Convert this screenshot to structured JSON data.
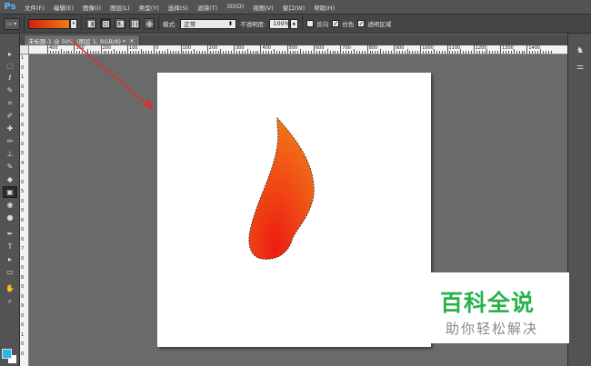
{
  "app": {
    "logo": "Ps",
    "menu": [
      "文件(F)",
      "编辑(E)",
      "图像(I)",
      "图层(L)",
      "类型(Y)",
      "选择(S)",
      "滤镜(T)",
      "3D(D)",
      "视图(V)",
      "窗口(W)",
      "帮助(H)"
    ]
  },
  "options_bar": {
    "mode_label": "模式:",
    "mode_value": "正常",
    "opacity_label": "不透明度:",
    "opacity_value": "100%",
    "reverse_label": "反向",
    "dither_label": "仿色",
    "transparency_label": "透明区域",
    "reverse_checked": false,
    "dither_checked": true,
    "transparency_checked": true,
    "gradient_colors": [
      "#d42010",
      "#f07a18"
    ]
  },
  "document": {
    "tab_title": "未标题-1 @ 50% (图层 1, RGB/8) *",
    "tab_close": "×"
  },
  "ruler": {
    "h_labels": [
      "400",
      "300",
      "200",
      "100",
      "0",
      "100",
      "200",
      "300",
      "400",
      "500",
      "600",
      "700",
      "800",
      "900",
      "1000",
      "1100",
      "1200",
      "1300",
      "1400"
    ],
    "v_labels": [
      "1",
      "0",
      "1",
      "0",
      "0",
      "2",
      "0",
      "0",
      "3",
      "0",
      "0",
      "4",
      "0",
      "0",
      "5",
      "0",
      "0",
      "6",
      "0",
      "0",
      "7",
      "0",
      "0",
      "8",
      "0",
      "0",
      "9",
      "0",
      "0",
      "1",
      "0",
      "0"
    ]
  },
  "tools": {
    "icons": [
      "move-icon",
      "marquee-icon",
      "lasso-icon",
      "quick-select-icon",
      "crop-icon",
      "eyedropper-icon",
      "healing-icon",
      "brush-icon",
      "stamp-icon",
      "history-brush-icon",
      "eraser-icon",
      "gradient-icon",
      "blur-icon",
      "dodge-icon",
      "pen-icon",
      "type-icon",
      "path-select-icon",
      "shape-icon",
      "hand-icon",
      "zoom-icon"
    ],
    "glyphs": [
      "▸",
      "⬚",
      "ℓ",
      "✎",
      "⌗",
      "✐",
      "✚",
      "✏",
      "⊥",
      "✎",
      "◆",
      "▣",
      "◉",
      "●",
      "✒",
      "T",
      "▸",
      "▭",
      "✋",
      "⌕"
    ],
    "foreground_color": "#27b6ef",
    "background_color": "#ffffff"
  },
  "watermark": {
    "title": "百科全说",
    "subtitle": "助你轻松解决"
  },
  "colors": {
    "flame_bottom": "#ee1c12",
    "flame_top": "#f07a18",
    "annotation_arrow": "#e8282a"
  }
}
